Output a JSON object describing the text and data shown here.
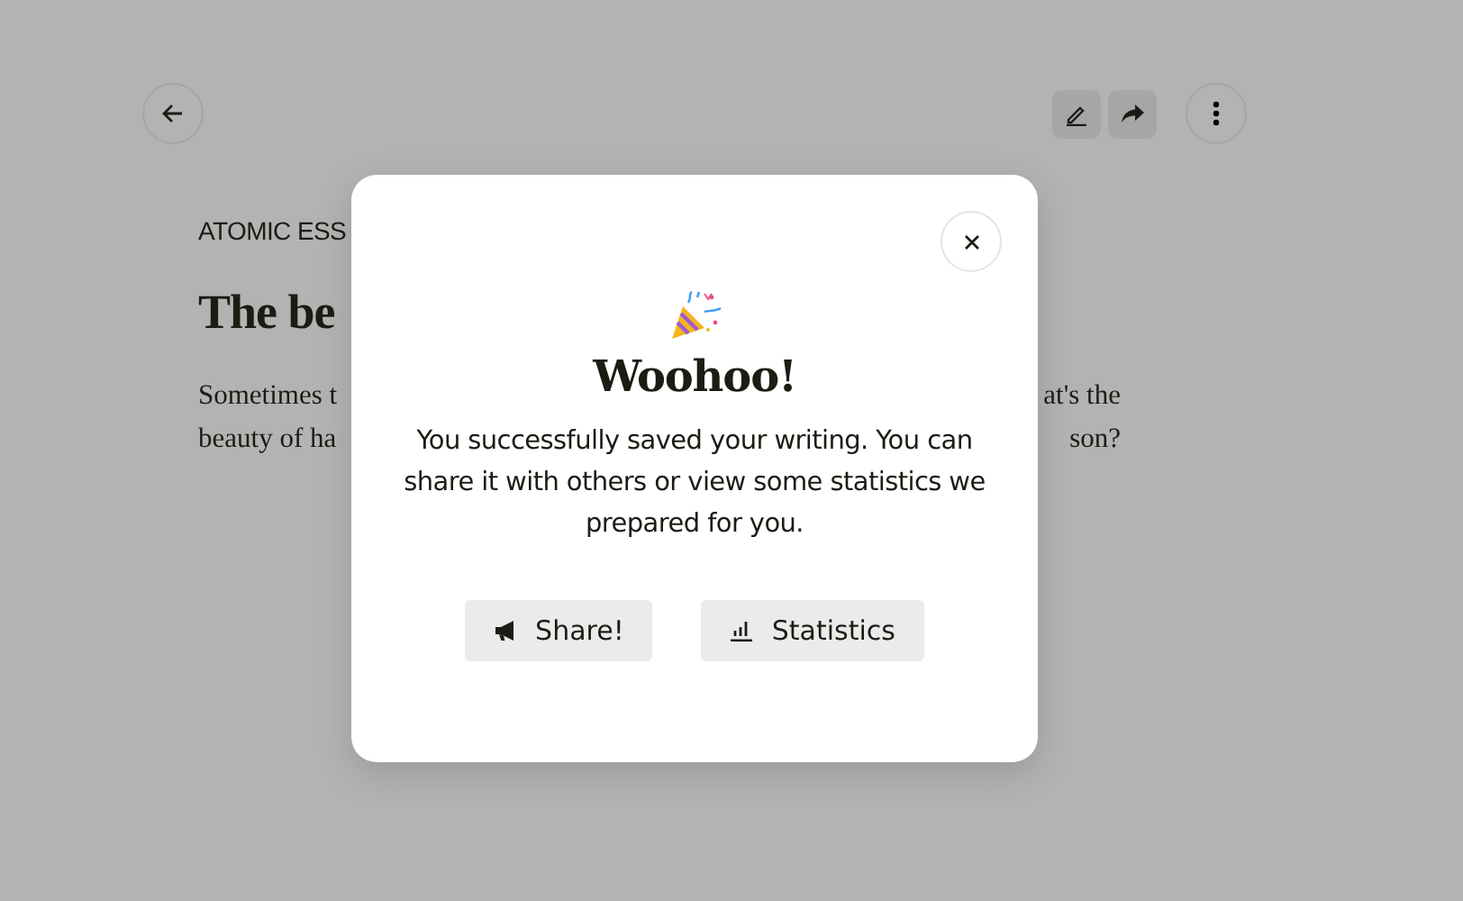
{
  "page": {
    "category": "ATOMIC ESS",
    "title": "The be",
    "body_left": [
      "Sometimes t",
      "beauty of ha"
    ],
    "body_right": [
      "at's the",
      "son?"
    ]
  },
  "modal": {
    "title": "Woohoo!",
    "message": "You successfully saved your writing. You can share it with others or view some statistics we prepared for you.",
    "buttons": [
      {
        "kind": "share",
        "label": "Share!"
      },
      {
        "kind": "stats",
        "label": "Statistics"
      }
    ]
  }
}
